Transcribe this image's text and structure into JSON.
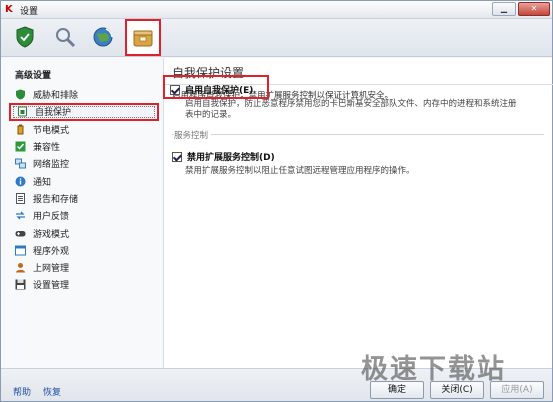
{
  "window": {
    "title": "设置",
    "minimize_label": "▁",
    "close_label": "✕"
  },
  "toolbar": {
    "tabs": [
      "protection",
      "scan",
      "update",
      "settings"
    ]
  },
  "sidebar": {
    "section_title": "高级设置",
    "items": [
      {
        "label": "威胁和排除",
        "icon": "shield-check-icon",
        "color": "#2e8b3a"
      },
      {
        "label": "自我保护",
        "icon": "lock-icon",
        "color": "#2e7d3a",
        "selected": true
      },
      {
        "label": "节电模式",
        "icon": "battery-icon",
        "color": "#c08010"
      },
      {
        "label": "兼容性",
        "icon": "checkmark-icon",
        "color": "#2a9a3a"
      },
      {
        "label": "网络监控",
        "icon": "network-icon",
        "color": "#3a7ac0"
      },
      {
        "label": "通知",
        "icon": "info-icon",
        "color": "#2f78c5"
      },
      {
        "label": "报告和存储",
        "icon": "document-icon",
        "color": "#555555"
      },
      {
        "label": "用户反馈",
        "icon": "arrows-icon",
        "color": "#2f78c5"
      },
      {
        "label": "游戏模式",
        "icon": "gamepad-icon",
        "color": "#444444"
      },
      {
        "label": "程序外观",
        "icon": "window-icon",
        "color": "#2f78c5"
      },
      {
        "label": "上网管理",
        "icon": "user-icon",
        "color": "#c06a20"
      },
      {
        "label": "设置管理",
        "icon": "floppy-icon",
        "color": "#444444"
      }
    ]
  },
  "main": {
    "page_title": "自我保护设置",
    "intro": "启用程序自我保护，禁用扩展服务控制以保证计算机安全。",
    "self_protect": {
      "label": "启用自我保护(E)",
      "checked": true,
      "desc_line1": "启用自我保护，防止恶意程序禁用您的卡巴斯基安全部队文件、内存中的进程和系统注册",
      "desc_line2": "表中的记录。"
    },
    "group_label": "服务控制",
    "service_control": {
      "label": "禁用扩展服务控制(D)",
      "checked": true,
      "desc": "禁用扩展服务控制以阻止任意试图远程管理应用程序的操作。"
    }
  },
  "footer": {
    "help": "帮助",
    "restore": "恢复",
    "ok": "确定",
    "close": "关闭(C)",
    "apply": "应用(A)"
  },
  "watermark": "极速下载站"
}
